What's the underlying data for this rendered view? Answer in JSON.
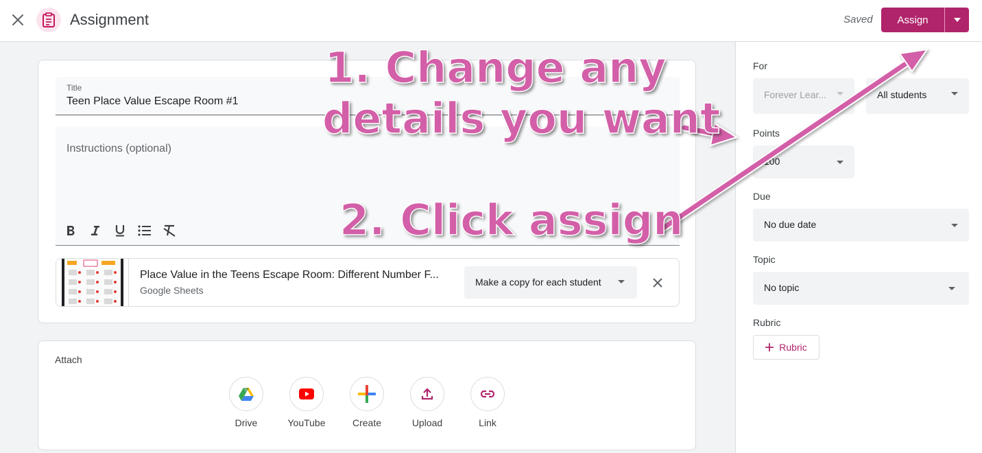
{
  "header": {
    "title": "Assignment",
    "saved_label": "Saved",
    "assign_label": "Assign"
  },
  "assignment": {
    "title_label": "Title",
    "title_value": "Teen Place Value Escape Room #1",
    "instructions_placeholder": "Instructions (optional)"
  },
  "formatting": [
    "bold-icon",
    "italic-icon",
    "underline-icon",
    "bulleted-list-icon",
    "clear-formatting-icon"
  ],
  "attachment": {
    "title": "Place Value in the Teens Escape Room: Different Number F...",
    "type": "Google Sheets",
    "share_mode": "Make a copy for each student"
  },
  "attach": {
    "heading": "Attach",
    "items": [
      {
        "label": "Drive",
        "icon": "drive-icon"
      },
      {
        "label": "YouTube",
        "icon": "youtube-icon"
      },
      {
        "label": "Create",
        "icon": "create-icon"
      },
      {
        "label": "Upload",
        "icon": "upload-icon"
      },
      {
        "label": "Link",
        "icon": "link-icon"
      }
    ]
  },
  "sidebar": {
    "for_label": "For",
    "class_value": "Forever Lear...",
    "students_value": "All students",
    "points_label": "Points",
    "points_value": "100",
    "due_label": "Due",
    "due_value": "No due date",
    "topic_label": "Topic",
    "topic_value": "No topic",
    "rubric_label": "Rubric",
    "rubric_button": "Rubric"
  },
  "annotations": {
    "step1_line1": "1. Change any",
    "step1_line2": "details you want",
    "step2": "2. Click assign"
  },
  "colors": {
    "accent": "#b0246b",
    "annotation": "#d35fa8"
  }
}
